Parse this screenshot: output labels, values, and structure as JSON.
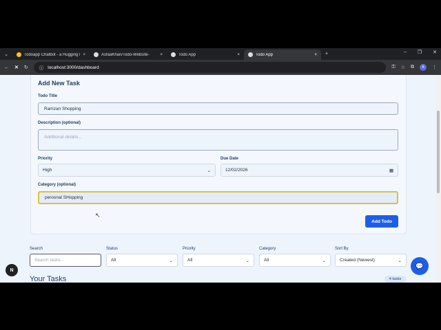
{
  "browser": {
    "tabs": [
      {
        "title": "Todoapp Chatbot - a Hugging F"
      },
      {
        "title": "AsfaaKhan/Todo-Website-"
      },
      {
        "title": "Todo App"
      },
      {
        "title": "Todo App"
      }
    ],
    "url": "localhost:3000/dashboard",
    "profile": "A"
  },
  "form": {
    "heading": "Add New Task",
    "title_label": "Todo Title",
    "title_value": "Ramzan Shopping",
    "desc_label": "Description (optional)",
    "desc_placeholder": "Additional details...",
    "priority_label": "Priority",
    "priority_value": "High",
    "due_label": "Due Date",
    "due_value": "12/02/2026",
    "category_label": "Category (optional)",
    "category_value": "perosnal SHopping",
    "submit": "Add Todo"
  },
  "filters": {
    "search_label": "Search",
    "search_placeholder": "Search tasks...",
    "status_label": "Status",
    "status_value": "All",
    "priority_label": "Priority",
    "priority_value": "All",
    "category_label": "Category",
    "category_value": "All",
    "sort_label": "Sort By",
    "sort_value": "Created (Newest)"
  },
  "tasks": {
    "heading": "Your Tasks",
    "count": "4 tasks"
  },
  "avatar": "N"
}
